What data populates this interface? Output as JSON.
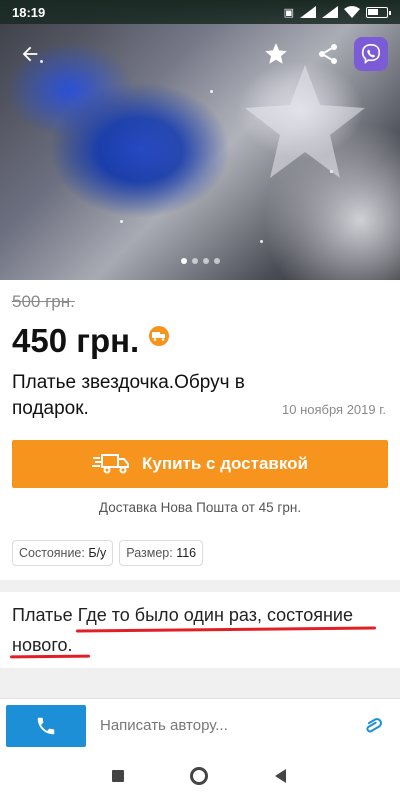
{
  "status_bar": {
    "time": "18:19",
    "battery_icon": "battery-icon"
  },
  "gallery": {
    "slides": 4,
    "active_slide": 1
  },
  "listing": {
    "old_price": "500 грн.",
    "price": "450 грн.",
    "title": "Платье звездочка.Обруч в подарок.",
    "date": "10 ноября 2019 г.",
    "buy_button_label": "Купить с доставкой",
    "delivery_info": "Доставка Нова Пошта от 45 грн.",
    "attributes": [
      {
        "label": "Состояние:",
        "value": "Б/у"
      },
      {
        "label": "Размер:",
        "value": "116"
      }
    ],
    "description": "Платье Где то было один раз, состояние нового."
  },
  "bottom_bar": {
    "message_placeholder": "Написать автору..."
  },
  "colors": {
    "accent_orange": "#f7941d",
    "call_blue": "#1d8fd6",
    "viber_purple": "#7b5bd6",
    "annotation_red": "#e31f26"
  }
}
